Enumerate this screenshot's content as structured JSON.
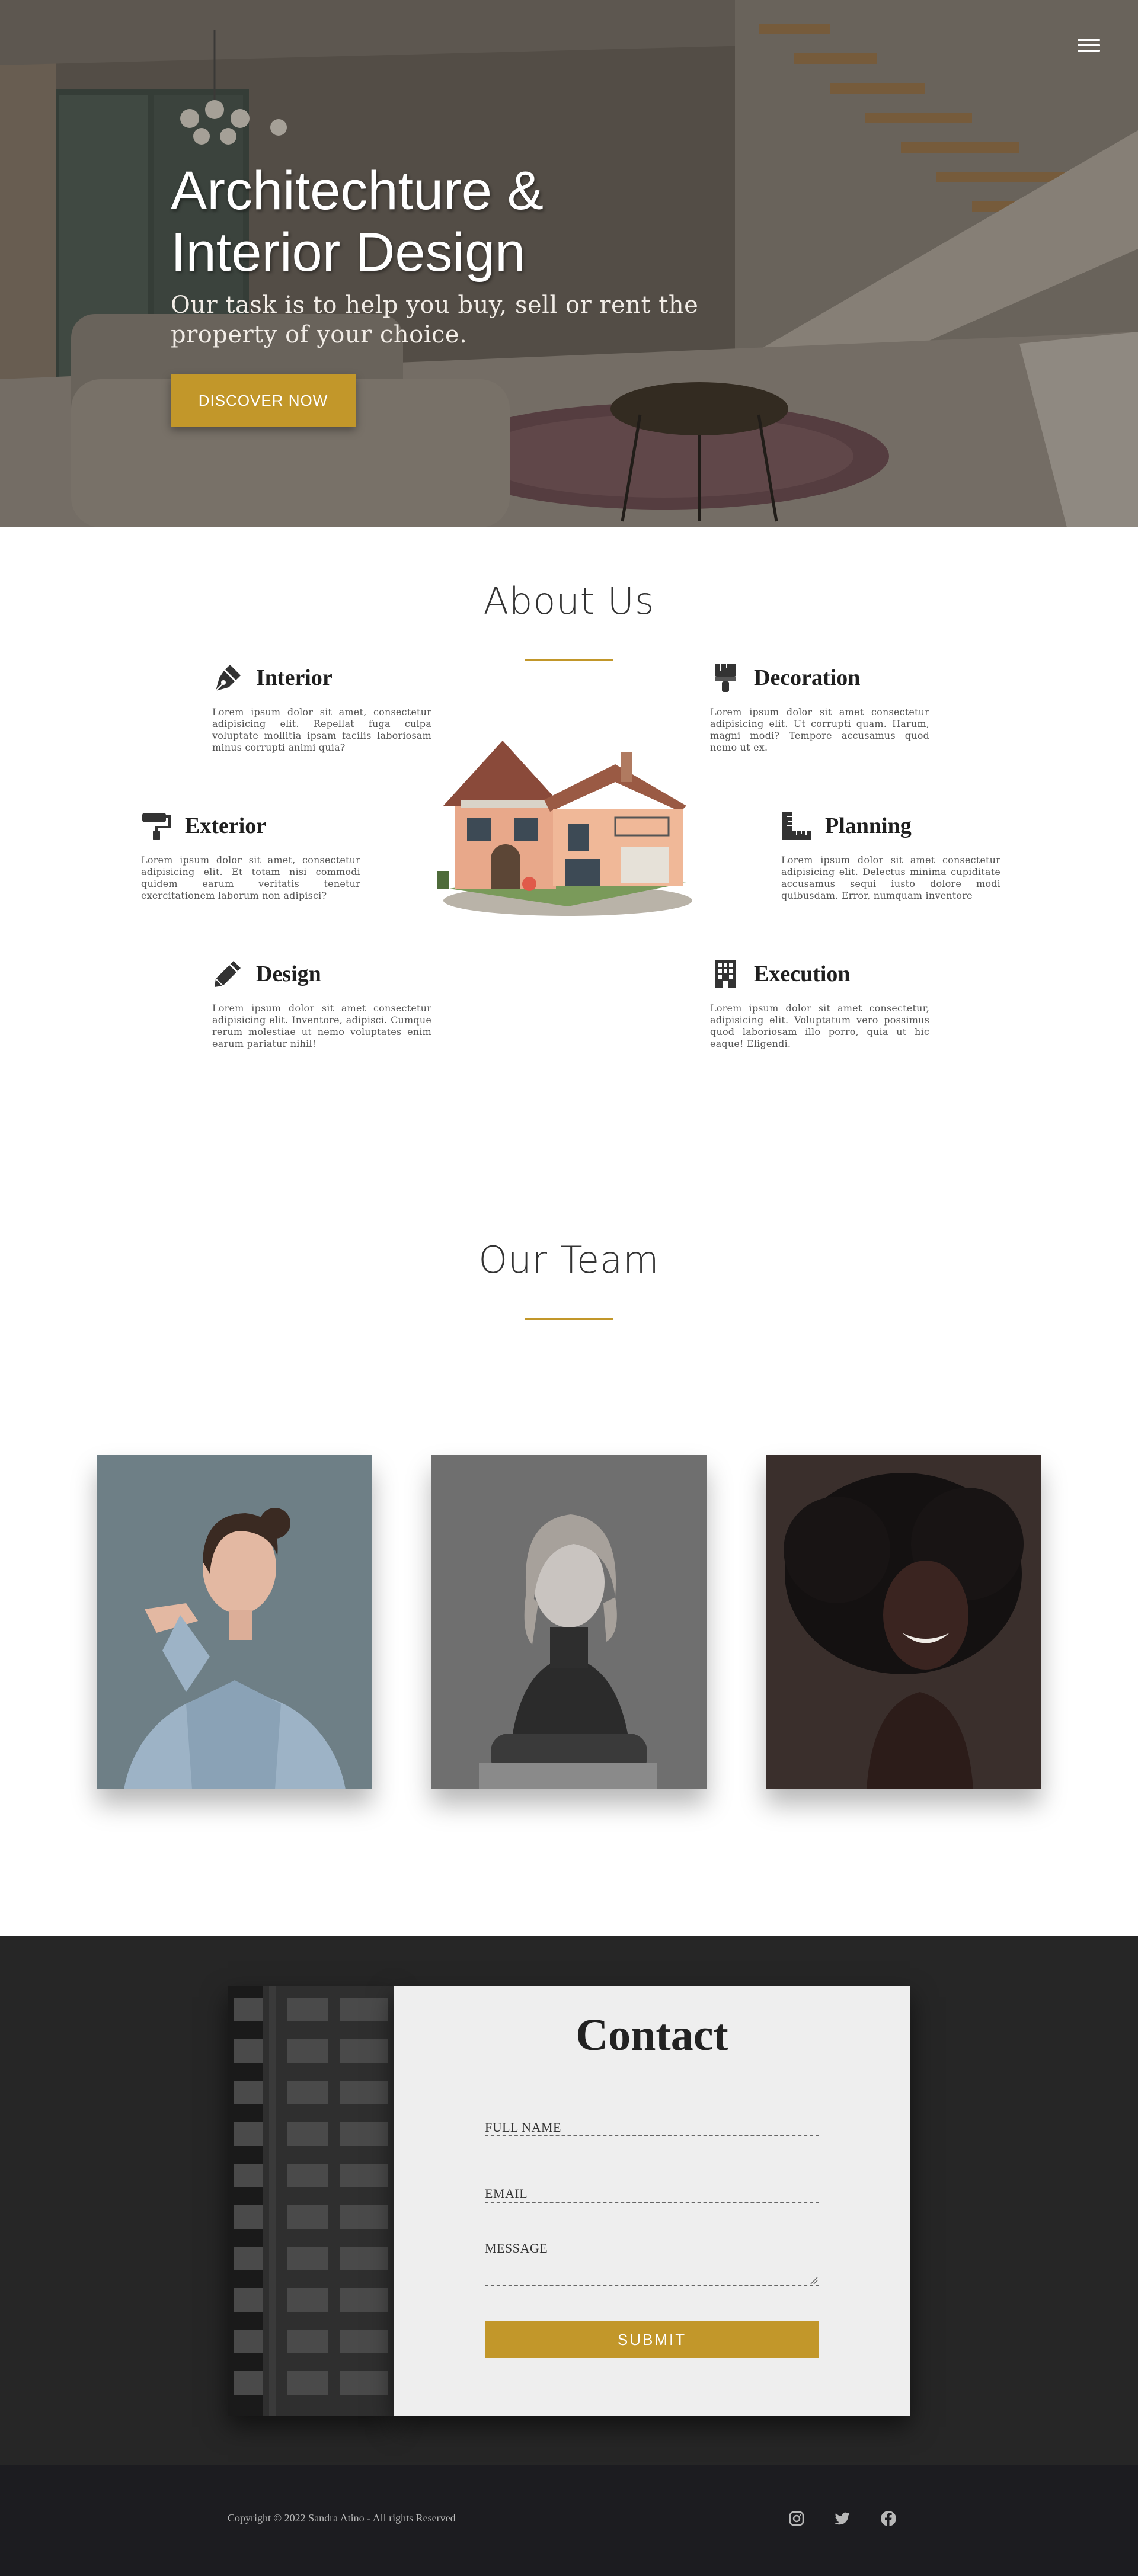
{
  "hero": {
    "title": "Architechture &\nInterior Design",
    "subtitle": "Our task is to help you buy, sell or rent the property of your choice.",
    "cta_label": "DISCOVER NOW"
  },
  "nav": {
    "menu_icon": "hamburger-menu-icon"
  },
  "about": {
    "title": "About Us",
    "features": [
      {
        "title": "Interior",
        "icon": "pen-nib-icon",
        "text": "Lorem ipsum dolor sit amet, consectetur adipisicing elit. Repellat fuga culpa voluptate mollitia ipsam facilis laboriosam minus corrupti animi quia?"
      },
      {
        "title": "Decoration",
        "icon": "paint-brush-icon",
        "text": "Lorem ipsum dolor sit amet consectetur adipisicing elit. Ut corrupti quam. Harum, magni modi? Tempore accusamus quod nemo ut ex."
      },
      {
        "title": "Exterior",
        "icon": "paint-roller-icon",
        "text": "Lorem ipsum dolor sit amet, consectetur adipisicing elit. Et totam nisi commodi quidem earum veritatis tenetur exercitationem laborum non adipisci?"
      },
      {
        "title": "Planning",
        "icon": "ruler-combined-icon",
        "text": "Lorem ipsum dolor sit amet consectetur adipisicing elit. Delectus minima cupiditate accusamus sequi iusto dolore modi quibusdam. Error, numquam inventore"
      },
      {
        "title": "Design",
        "icon": "pencil-icon",
        "text": "Lorem ipsum dolor sit amet consectetur adipisicing elit. Inventore, adipisci. Cumque rerum molestiae ut nemo voluptates enim earum pariatur nihil!"
      },
      {
        "title": "Execution",
        "icon": "building-icon",
        "text": "Lorem ipsum dolor sit amet consectetur, adipisicing elit. Voluptatum vero possimus quod laboriosam illo porro, quia ut hic eaque! Eligendi."
      }
    ]
  },
  "team": {
    "title": "Our Team",
    "members": [
      {
        "photo": "woman-in-blue-blazer-pointing-photo"
      },
      {
        "photo": "woman-in-black-turtleneck-photo"
      },
      {
        "photo": "smiling-woman-with-afro-photo"
      }
    ]
  },
  "contact": {
    "title": "Contact",
    "full_name_label": "FULL NAME",
    "email_label": "EMAIL",
    "message_label": "MESSAGE",
    "submit_label": "SUBMIT"
  },
  "footer": {
    "copyright": "Copyright © 2022 Sandra Atino - All rights Reserved",
    "social": [
      "instagram-icon",
      "twitter-icon",
      "facebook-icon"
    ]
  },
  "colors": {
    "accent": "#c2972a",
    "dark_section": "#262626",
    "footer": "#1c1c20",
    "card": "#eeeeee"
  }
}
